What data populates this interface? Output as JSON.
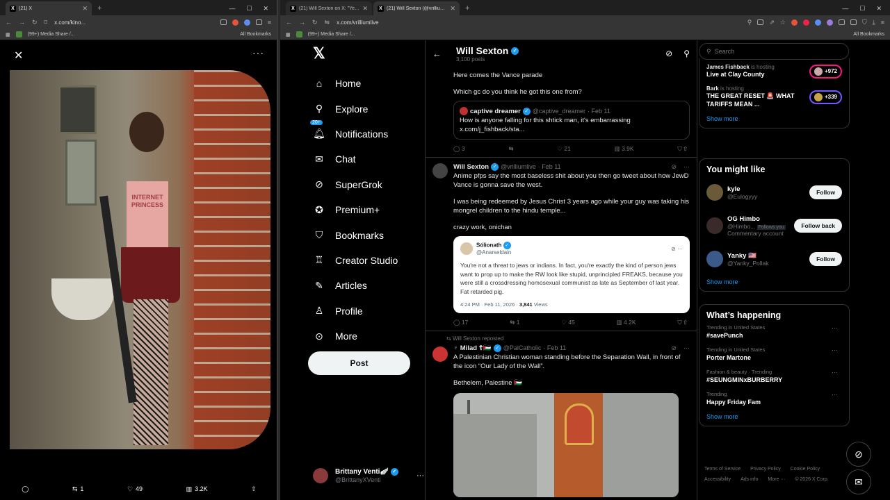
{
  "left_window": {
    "tab_title": "(21) X",
    "url": "x.com/kino...",
    "bookmark": "(99+) Media Share /...",
    "all_bookmarks": "All Bookmarks",
    "photo_text": "INTERNET\nPRINCESS",
    "bar": {
      "replies": "",
      "reposts": "1",
      "likes": "49",
      "views": "3.2K"
    }
  },
  "right_window": {
    "tabs": [
      {
        "title": "(21) Will Sexton on X: \"Year of the V..."
      },
      {
        "title": "(21) Will Sexton (@vrilliumlive) / ..."
      }
    ],
    "url": "x.com/vrilliumlive",
    "bookmark": "(99+) Media Share /...",
    "all_bookmarks": "All Bookmarks"
  },
  "nav": {
    "items": [
      {
        "label": "Home",
        "icon": "home-icon"
      },
      {
        "label": "Explore",
        "icon": "search-icon"
      },
      {
        "label": "Notifications",
        "icon": "bell-icon",
        "badge": "20+"
      },
      {
        "label": "Chat",
        "icon": "mail-icon"
      },
      {
        "label": "SuperGrok",
        "icon": "grok-icon"
      },
      {
        "label": "Premium+",
        "icon": "verified-icon"
      },
      {
        "label": "Bookmarks",
        "icon": "bookmark-icon"
      },
      {
        "label": "Creator Studio",
        "icon": "studio-icon"
      },
      {
        "label": "Articles",
        "icon": "articles-icon"
      },
      {
        "label": "Profile",
        "icon": "profile-icon"
      },
      {
        "label": "More",
        "icon": "more-icon"
      }
    ],
    "post": "Post",
    "account": {
      "name": "Brittany Venti🪽",
      "handle": "@BrittanyXVenti"
    }
  },
  "profile_header": {
    "name": "Will Sexton",
    "posts": "3,100 posts"
  },
  "posts": [
    {
      "text1": "Here comes the Vance parade",
      "text2": "Which gc do you think he got this one from?",
      "quote": {
        "name": "captive dreamer",
        "handle": "@captive_dreamer",
        "date": "· Feb 11",
        "text": "How is anyone falling for this shtick man, it's embarrassing x.com/j_fishback/sta..."
      },
      "actions": {
        "replies": "3",
        "reposts": "",
        "likes": "21",
        "views": "3.9K"
      }
    },
    {
      "name": "Will Sexton",
      "handle": "@vrilliumlive",
      "date": "· Feb 11",
      "text1": "Anime pfps say the most baseless shit about you then go tweet about how JewD Vance is gonna save the west.",
      "text2": "I was being redeemed by Jesus Christ 3 years ago while your guy was taking his mongrel children to the hindu temple...",
      "text3": "crazy work, onichan",
      "quote": {
        "name": "Sólionath",
        "handle": "@Anarseldain",
        "text": "You're not a threat to jews or indians. In fact, you're exactly the kind of person jews want to prop up to make the RW look like stupid, unprincipled FREAKS, because you were still a crossdressing homosexual communist as late as September of last year. Fat retarded pig.",
        "time": "4:24 PM · Feb 11, 2026 · ",
        "views_count": "3,841",
        "views_label": " Views"
      },
      "actions": {
        "replies": "17",
        "reposts": "1",
        "likes": "45",
        "views": "4.2K"
      }
    },
    {
      "repost_label": "Will Sexton reposted",
      "name": "♇ Milad ☦︎🇵🇸",
      "handle": "@PalCatholic",
      "date": "· Feb 11",
      "text1": "A Palestinian Christian woman standing before the Separation Wall, in front of the icon “Our Lady of the Wall”.",
      "text2": "Bethelem, Palestine 🇵🇸"
    }
  ],
  "sidebar": {
    "search_placeholder": "Search",
    "spaces": [
      {
        "host": "James Fishback",
        "status": "is hosting",
        "title": "Live at Clay County",
        "count": "+972"
      },
      {
        "host": "Bark",
        "status": "is hosting",
        "title": "THE GREAT RESET 🚨 WHAT TARIFFS MEAN ...",
        "count": "+339"
      }
    ],
    "spaces_more": "Show more",
    "wtf_title": "You might like",
    "follows": [
      {
        "name": "kyle",
        "handle": "@Eulogyyy",
        "btn": "Follow"
      },
      {
        "name": "OG Himbo",
        "handle": "@Himbo...",
        "tag": "Follows you",
        "sub": "Commentary account",
        "btn": "Follow back"
      },
      {
        "name": "Yanky 🇺🇸",
        "handle": "@Yanky_Pollak",
        "btn": "Follow"
      }
    ],
    "wtf_more": "Show more",
    "trends_title": "What’s happening",
    "trends": [
      {
        "ctx": "Trending in United States",
        "topic": "#savePunch"
      },
      {
        "ctx": "Trending in United States",
        "topic": "Porter Martone"
      },
      {
        "ctx": "Fashion & beauty · Trending",
        "topic": "#SEUNGMINxBURBERRY"
      },
      {
        "ctx": "Trending",
        "topic": "Happy Friday Fam"
      }
    ],
    "trends_more": "Show more",
    "footer": [
      "Terms of Service",
      "Privacy Policy",
      "Cookie Policy",
      "Accessibility",
      "Ads info",
      "More ···",
      "© 2026 X Corp."
    ]
  }
}
